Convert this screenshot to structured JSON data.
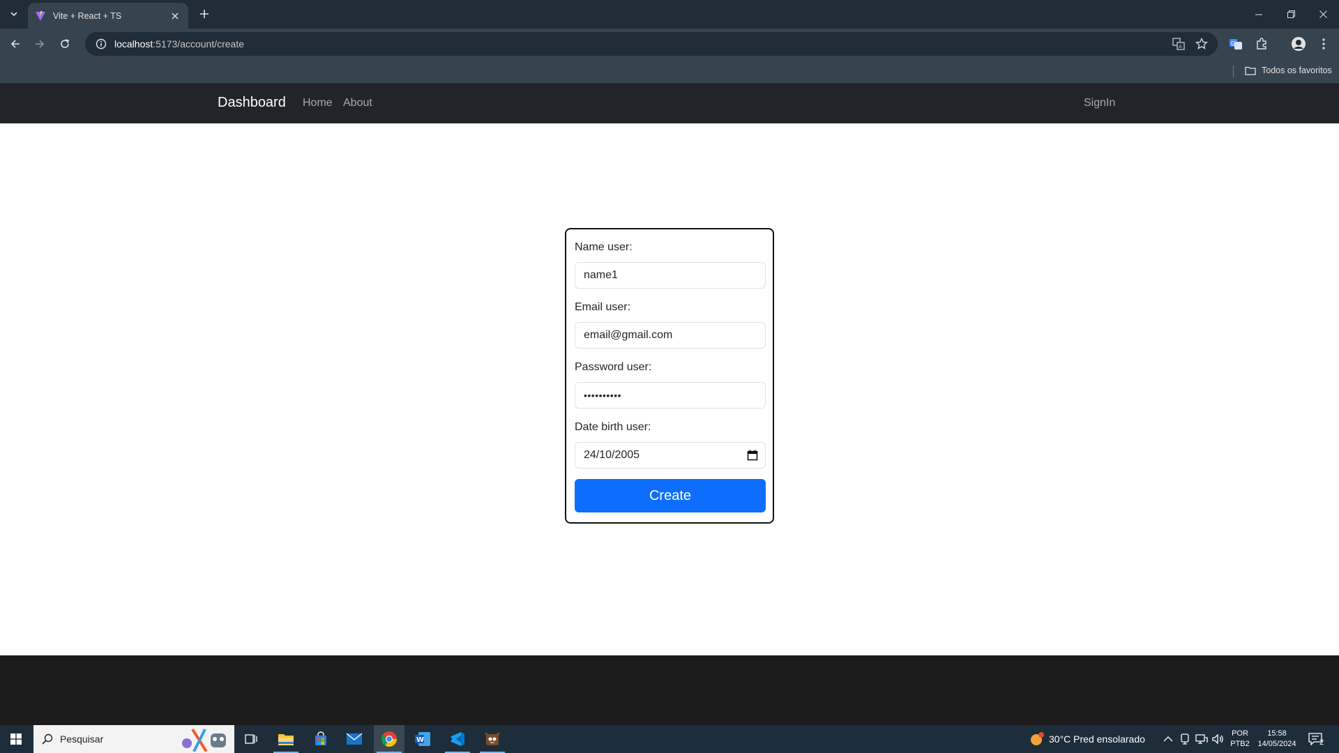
{
  "browser": {
    "tab_title": "Vite + React + TS",
    "url_host": "localhost",
    "url_path": ":5173/account/create",
    "bookmarks_all": "Todos os favoritos"
  },
  "navbar": {
    "brand": "Dashboard",
    "links": [
      "Home",
      "About"
    ],
    "signin": "SignIn"
  },
  "form": {
    "name_label": "Name user:",
    "name_value": "name1",
    "email_label": "Email user:",
    "email_value": "email@gmail.com",
    "password_label": "Password user:",
    "password_masked": "••••••••••",
    "birth_label": "Date birth user:",
    "birth_value": "24/10/2005",
    "submit_label": "Create"
  },
  "taskbar": {
    "search_placeholder": "Pesquisar",
    "weather": "30°C  Pred ensolarado",
    "language_top": "POR",
    "language_bottom": "PTB2",
    "time": "15:58",
    "date": "14/05/2024",
    "notification_count": "2"
  },
  "colors": {
    "primary": "#0d6efd",
    "navbar_bg": "#212529",
    "chrome_bg": "#35444f"
  }
}
